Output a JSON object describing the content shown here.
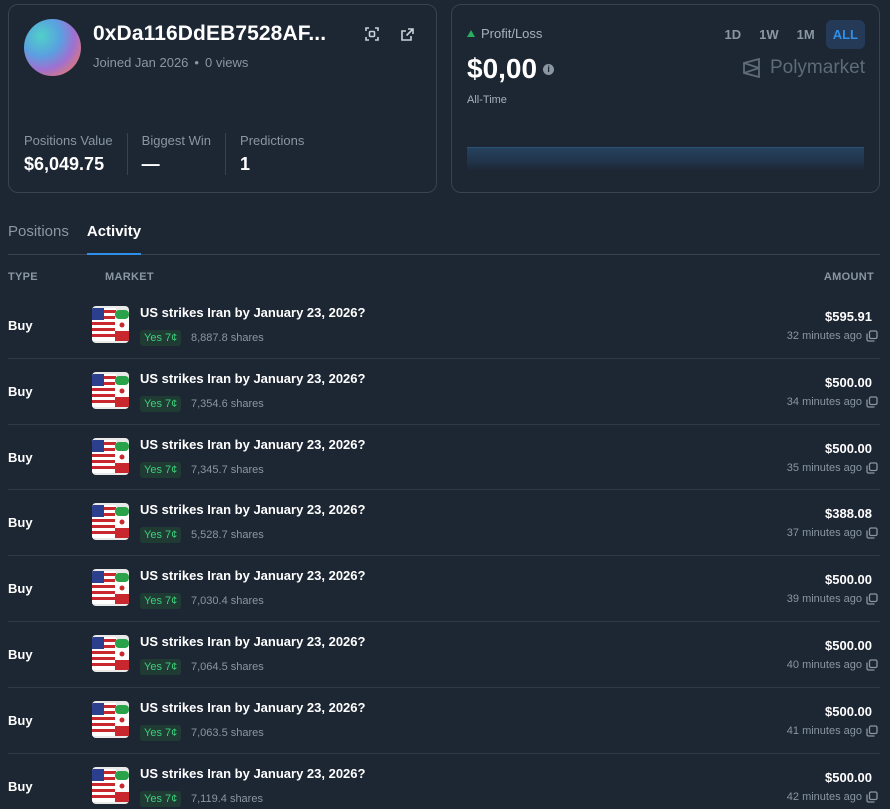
{
  "profile": {
    "username": "0xDa116DdEB7528AF...",
    "joined": "Joined Jan 2026",
    "views": "0 views",
    "stats": [
      {
        "label": "Positions Value",
        "value": "$6,049.75"
      },
      {
        "label": "Biggest Win",
        "value": "—"
      },
      {
        "label": "Predictions",
        "value": "1"
      }
    ]
  },
  "pnl": {
    "label": "Profit/Loss",
    "value": "$0,00",
    "period": "All-Time",
    "ranges": [
      "1D",
      "1W",
      "1M",
      "ALL"
    ],
    "active_range": "ALL",
    "brand": "Polymarket"
  },
  "tabs": {
    "positions": "Positions",
    "activity": "Activity",
    "active": "Activity"
  },
  "columns": {
    "type": "TYPE",
    "market": "MARKET",
    "amount": "AMOUNT"
  },
  "activity": [
    {
      "type": "Buy",
      "market": "US strikes Iran by January 23, 2026?",
      "outcome": "Yes 7¢",
      "shares": "8,887.8 shares",
      "amount": "$595.91",
      "time": "32 minutes ago"
    },
    {
      "type": "Buy",
      "market": "US strikes Iran by January 23, 2026?",
      "outcome": "Yes 7¢",
      "shares": "7,354.6 shares",
      "amount": "$500.00",
      "time": "34 minutes ago"
    },
    {
      "type": "Buy",
      "market": "US strikes Iran by January 23, 2026?",
      "outcome": "Yes 7¢",
      "shares": "7,345.7 shares",
      "amount": "$500.00",
      "time": "35 minutes ago"
    },
    {
      "type": "Buy",
      "market": "US strikes Iran by January 23, 2026?",
      "outcome": "Yes 7¢",
      "shares": "5,528.7 shares",
      "amount": "$388.08",
      "time": "37 minutes ago"
    },
    {
      "type": "Buy",
      "market": "US strikes Iran by January 23, 2026?",
      "outcome": "Yes 7¢",
      "shares": "7,030.4 shares",
      "amount": "$500.00",
      "time": "39 minutes ago"
    },
    {
      "type": "Buy",
      "market": "US strikes Iran by January 23, 2026?",
      "outcome": "Yes 7¢",
      "shares": "7,064.5 shares",
      "amount": "$500.00",
      "time": "40 minutes ago"
    },
    {
      "type": "Buy",
      "market": "US strikes Iran by January 23, 2026?",
      "outcome": "Yes 7¢",
      "shares": "7,063.5 shares",
      "amount": "$500.00",
      "time": "41 minutes ago"
    },
    {
      "type": "Buy",
      "market": "US strikes Iran by January 23, 2026?",
      "outcome": "Yes 7¢",
      "shares": "7,119.4 shares",
      "amount": "$500.00",
      "time": "42 minutes ago"
    }
  ],
  "colors": {
    "background": "#1d2633",
    "accent": "#2e8fe8",
    "positive": "#3dd07c",
    "muted": "#8a96a4"
  },
  "icons": {
    "scan": "qr-scan-icon",
    "external": "external-link-icon",
    "info": "info-icon",
    "copy": "copy-icon",
    "market_thumb": "us-iran-flags-icon",
    "brand_logo": "polymarket-logo-icon"
  }
}
